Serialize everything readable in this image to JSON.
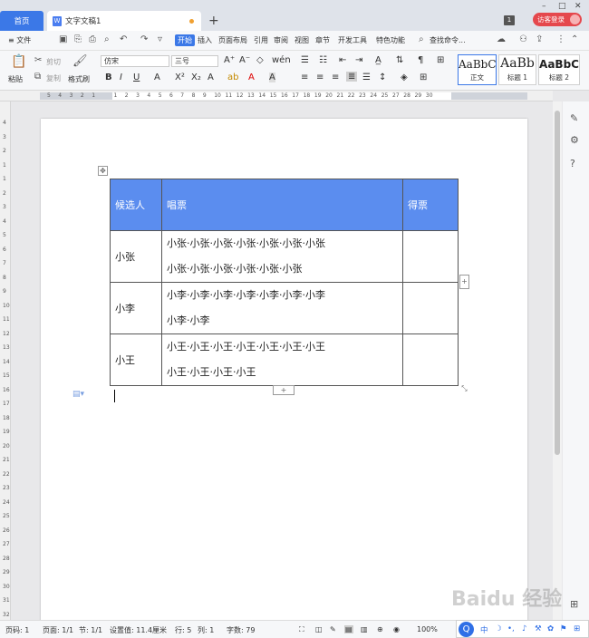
{
  "tabs": {
    "home": "首页",
    "doc": "文字文稿1",
    "add": "+"
  },
  "window": {
    "count": "1",
    "login": "访客登录"
  },
  "menu": {
    "file": "≡ 文件",
    "items": [
      "开始",
      "插入",
      "页面布局",
      "引用",
      "审阅",
      "视图",
      "章节",
      "开发工具",
      "特色功能"
    ],
    "search": "查找命令..."
  },
  "ribbon": {
    "paste": "粘贴",
    "cut": "剪切",
    "copy": "复制",
    "format_painter": "格式刷",
    "font_family": "仿宋",
    "font_size": "三号",
    "styles": [
      {
        "sample": "AaBbCcDd",
        "name": "正文"
      },
      {
        "sample": "AaBb",
        "name": "标题 1"
      },
      {
        "sample": "AaBbC",
        "name": "标题 2"
      }
    ]
  },
  "ruler_numbers": [
    "5",
    "4",
    "3",
    "2",
    "1",
    "1",
    "2",
    "3",
    "4",
    "5",
    "6",
    "7",
    "8",
    "9",
    "10",
    "11",
    "12",
    "13",
    "14",
    "15",
    "16",
    "17",
    "18",
    "19",
    "20",
    "21",
    "22",
    "23",
    "24",
    "25",
    "27",
    "28",
    "29",
    "30"
  ],
  "table": {
    "headers": [
      "候选人",
      "唱票",
      "得票"
    ],
    "rows": [
      {
        "name": "小张",
        "votes_line1": "小张·小张·小张·小张·小张·小张·小张",
        "votes_line2": "小张·小张·小张·小张·小张·小张",
        "count": ""
      },
      {
        "name": "小李",
        "votes_line1": "小李·小李·小李·小李·小李·小李·小李",
        "votes_line2": "小李·小李",
        "count": ""
      },
      {
        "name": "小王",
        "votes_line1": "小王·小王·小王·小王·小王·小王·小王",
        "votes_line2": "小王·小王·小王·小王",
        "count": ""
      }
    ]
  },
  "status": {
    "page": "页码: 1",
    "pages": "页面: 1/1",
    "section": "节: 1/1",
    "setting": "设置值: 11.4厘米",
    "row": "行: 5",
    "col": "列: 1",
    "words": "字数: 79",
    "zoom": "100%"
  },
  "ime": {
    "mode": "中"
  },
  "watermark": "Baidu 经验"
}
